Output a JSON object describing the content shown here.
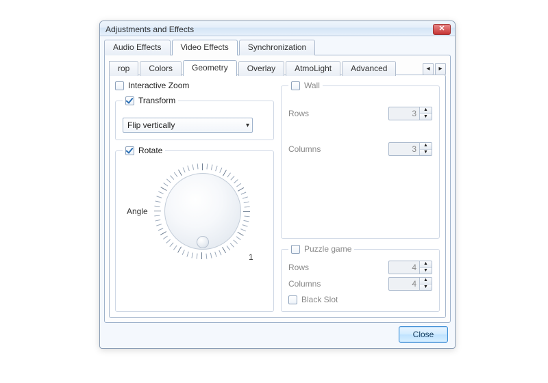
{
  "window": {
    "title": "Adjustments and Effects",
    "close_label": "Close"
  },
  "icons": {
    "close": "✕",
    "caret_down": "▾",
    "arrow_left": "◂",
    "arrow_right": "▸",
    "spin_up": "▲",
    "spin_down": "▼"
  },
  "top_tabs": {
    "items": [
      {
        "id": "audio-effects",
        "label": "Audio Effects"
      },
      {
        "id": "video-effects",
        "label": "Video Effects"
      },
      {
        "id": "synchronization",
        "label": "Synchronization"
      }
    ],
    "active": "video-effects"
  },
  "sub_tabs": {
    "items": [
      {
        "id": "crop",
        "label": "rop"
      },
      {
        "id": "colors",
        "label": "Colors"
      },
      {
        "id": "geometry",
        "label": "Geometry"
      },
      {
        "id": "overlay",
        "label": "Overlay"
      },
      {
        "id": "atmolight",
        "label": "AtmoLight"
      },
      {
        "id": "advanced",
        "label": "Advanced"
      }
    ],
    "active": "geometry"
  },
  "geometry": {
    "interactive_zoom": {
      "label": "Interactive Zoom",
      "checked": false
    },
    "transform": {
      "label": "Transform",
      "checked": true,
      "combo_value": "Flip vertically"
    },
    "rotate": {
      "label": "Rotate",
      "checked": true,
      "angle_label": "Angle",
      "tick_label": "1"
    },
    "wall": {
      "label": "Wall",
      "checked": false,
      "rows_label": "Rows",
      "rows_value": "3",
      "cols_label": "Columns",
      "cols_value": "3"
    },
    "puzzle": {
      "label": "Puzzle game",
      "checked": false,
      "rows_label": "Rows",
      "rows_value": "4",
      "cols_label": "Columns",
      "cols_value": "4",
      "black_slot_label": "Black Slot",
      "black_slot_checked": false
    }
  }
}
